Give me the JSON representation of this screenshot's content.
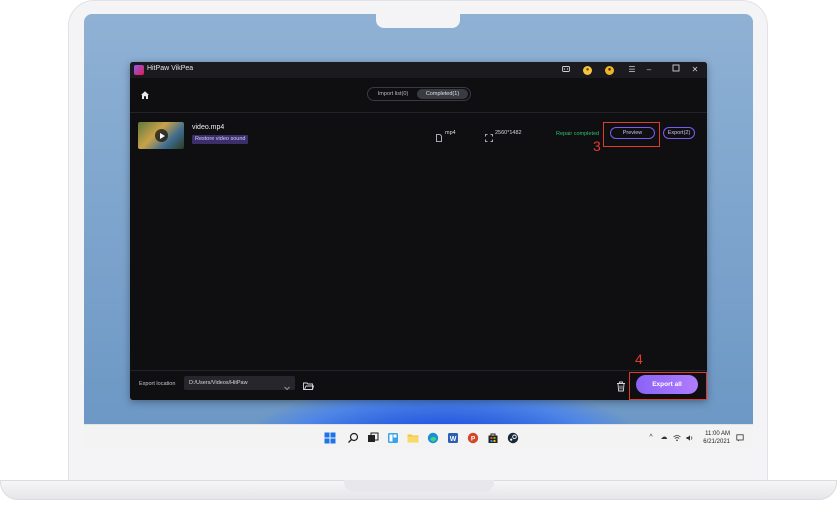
{
  "app": {
    "title": "HitPaw VikPea"
  },
  "tabs": [
    {
      "label": "Import list(0)",
      "active": false
    },
    {
      "label": "Completed(1)",
      "active": true
    }
  ],
  "file_row": {
    "filename": "video.mp4",
    "tag": "Restore video sound",
    "format": "mp4",
    "resolution": "2560*1482",
    "status": "Repair completed",
    "preview_label": "Preview",
    "export_label": "Export(2)"
  },
  "footer": {
    "export_location_label": "Export location",
    "path": "D:/Users/Videos/HitPaw",
    "export_all_label": "Export all"
  },
  "callouts": {
    "step3": "3",
    "step4": "4"
  },
  "taskbar": {
    "time": "11:00 AM",
    "date": "6/21/2021",
    "icons": [
      "windows-start-icon",
      "search-icon",
      "task-view-icon",
      "widgets-icon",
      "file-explorer-icon",
      "edge-icon",
      "word-icon",
      "powerpoint-icon",
      "store-icon",
      "steam-icon"
    ]
  },
  "colors": {
    "accent": "#8a63f5",
    "status_green": "#2fbf71",
    "callout_red": "#e23b2e",
    "app_bg": "#0f0f12"
  }
}
